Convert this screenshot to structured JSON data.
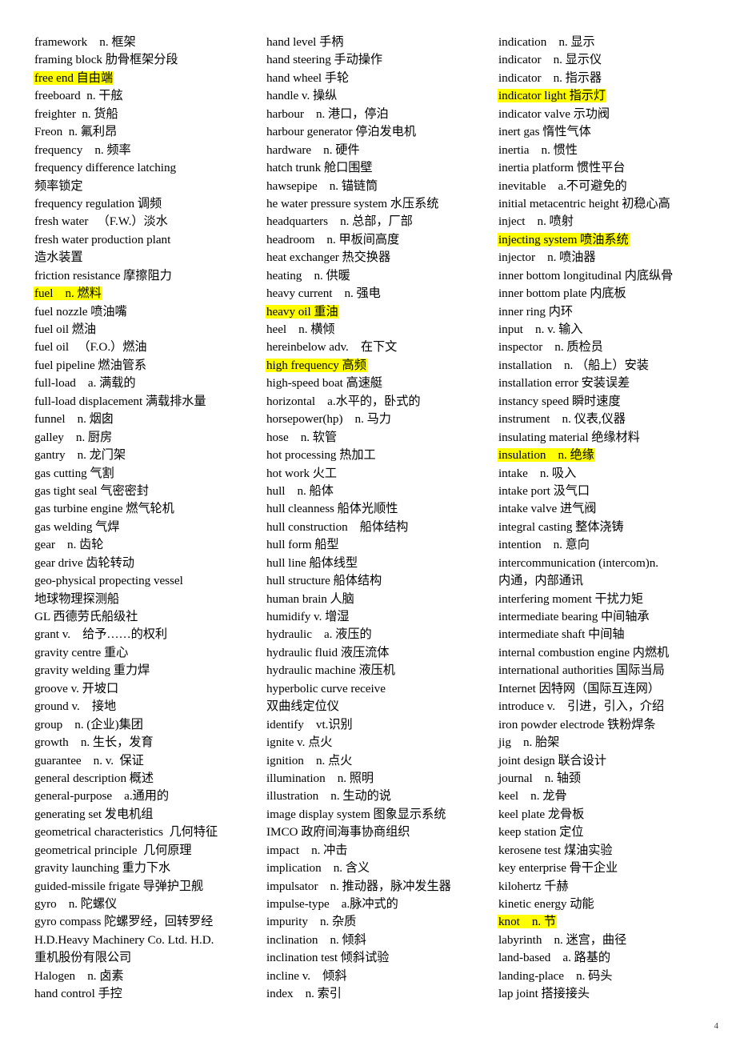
{
  "document": {
    "page_number": "4",
    "highlight_color": "#ffff00",
    "columns": [
      {
        "id": "column-1",
        "entries": [
          {
            "text": "framework n. 框架",
            "highlighted": false
          },
          {
            "text": "framing block  肋骨框架分段",
            "highlighted": false
          },
          {
            "text": "free end  自由端",
            "highlighted": true
          },
          {
            "text": "freeboard n. 干舷",
            "highlighted": false
          },
          {
            "text": "freighter n. 货船",
            "highlighted": false
          },
          {
            "text": "Freon n. 氟利昂",
            "highlighted": false
          },
          {
            "text": "frequency  n. 频率",
            "highlighted": false
          },
          {
            "text": "frequency difference latching",
            "highlighted": false
          },
          {
            "text": "频率锁定",
            "highlighted": false
          },
          {
            "text": "frequency regulation  调频",
            "highlighted": false
          },
          {
            "text": "fresh water  （F.W.）淡水",
            "highlighted": false
          },
          {
            "text": "fresh water production plant",
            "highlighted": false
          },
          {
            "text": "造水装置",
            "highlighted": false
          },
          {
            "text": "friction resistance  摩擦阻力",
            "highlighted": false
          },
          {
            "text": "fuel  n. 燃料",
            "highlighted": true
          },
          {
            "text": "fuel nozzle  喷油嘴",
            "highlighted": false
          },
          {
            "text": "fuel oil  燃油",
            "highlighted": false
          },
          {
            "text": "fuel oil  （F.O.）燃油",
            "highlighted": false
          },
          {
            "text": "fuel pipeline  燃油管系",
            "highlighted": false
          },
          {
            "text": "full-load  a. 满载的",
            "highlighted": false
          },
          {
            "text": "full-load displacement  满载排水量",
            "highlighted": false
          },
          {
            "text": "funnel  n. 烟囱",
            "highlighted": false
          },
          {
            "text": "galley  n. 厨房",
            "highlighted": false
          },
          {
            "text": "gantry  n. 龙门架",
            "highlighted": false
          },
          {
            "text": "gas cutting  气割",
            "highlighted": false
          },
          {
            "text": "gas tight seal  气密密封",
            "highlighted": false
          },
          {
            "text": "gas turbine engine  燃气轮机",
            "highlighted": false
          },
          {
            "text": "gas welding  气焊",
            "highlighted": false
          },
          {
            "text": "gear  n. 齿轮",
            "highlighted": false
          },
          {
            "text": "gear drive  齿轮转动",
            "highlighted": false
          },
          {
            "text": "geo-physical propecting vessel",
            "highlighted": false
          },
          {
            "text": "地球物理探测船",
            "highlighted": false
          },
          {
            "text": "GL  西德劳氏船级社",
            "highlighted": false
          },
          {
            "text": "grant v.  给予……的权利",
            "highlighted": false
          },
          {
            "text": "gravity centre  重心",
            "highlighted": false
          },
          {
            "text": "gravity welding  重力焊",
            "highlighted": false
          },
          {
            "text": "groove v.  开坡口",
            "highlighted": false
          },
          {
            "text": "ground v.  接地",
            "highlighted": false
          },
          {
            "text": "group  n. (企业)集团",
            "highlighted": false
          },
          {
            "text": "growth  n. 生长，发育",
            "highlighted": false
          },
          {
            "text": "guarantee  n. v. 保证",
            "highlighted": false
          },
          {
            "text": "general description  概述",
            "highlighted": false
          },
          {
            "text": "general-purpose  a.通用的",
            "highlighted": false
          },
          {
            "text": "generating set  发电机组",
            "highlighted": false
          },
          {
            "text": "geometrical characteristics 几何特征",
            "highlighted": false
          },
          {
            "text": "geometrical principle 几何原理",
            "highlighted": false
          },
          {
            "text": "gravity launching  重力下水",
            "highlighted": false
          },
          {
            "text": "guided-missile frigate  导弹护卫舰",
            "highlighted": false
          },
          {
            "text": "gyro  n. 陀螺仪",
            "highlighted": false
          },
          {
            "text": "gyro compass  陀螺罗经，回转罗经",
            "highlighted": false
          },
          {
            "text": "H.D.Heavy Machinery Co. Ltd. H.D.",
            "highlighted": false
          },
          {
            "text": "重机股份有限公司",
            "highlighted": false
          },
          {
            "text": "Halogen  n. 卤素",
            "highlighted": false
          },
          {
            "text": "hand control  手控",
            "highlighted": false
          }
        ]
      },
      {
        "id": "column-2",
        "entries": [
          {
            "text": "hand level  手柄",
            "highlighted": false
          },
          {
            "text": "hand steering  手动操作",
            "highlighted": false
          },
          {
            "text": "hand wheel  手轮",
            "highlighted": false
          },
          {
            "text": "handle v.  操纵",
            "highlighted": false
          },
          {
            "text": "harbour  n. 港口，停泊",
            "highlighted": false
          },
          {
            "text": "harbour generator  停泊发电机",
            "highlighted": false
          },
          {
            "text": "hardware  n. 硬件",
            "highlighted": false
          },
          {
            "text": "hatch trunk  舱口围壁",
            "highlighted": false
          },
          {
            "text": "hawsepipe  n. 锚链筒",
            "highlighted": false
          },
          {
            "text": "he water pressure system  水压系统",
            "highlighted": false
          },
          {
            "text": "headquarters  n. 总部，厂部",
            "highlighted": false
          },
          {
            "text": "headroom  n. 甲板间高度",
            "highlighted": false
          },
          {
            "text": "heat exchanger  热交换器",
            "highlighted": false
          },
          {
            "text": "heating  n. 供暖",
            "highlighted": false
          },
          {
            "text": "heavy current  n. 强电",
            "highlighted": false
          },
          {
            "text": "heavy oil  重油",
            "highlighted": true
          },
          {
            "text": "heel  n. 横倾",
            "highlighted": false
          },
          {
            "text": "hereinbelow adv.  在下文",
            "highlighted": false
          },
          {
            "text": "high frequency  高频",
            "highlighted": true
          },
          {
            "text": "high-speed boat  高速艇",
            "highlighted": false
          },
          {
            "text": "horizontal  a.水平的，卧式的",
            "highlighted": false
          },
          {
            "text": "horsepower(hp)  n. 马力",
            "highlighted": false
          },
          {
            "text": "hose  n. 软管",
            "highlighted": false
          },
          {
            "text": "hot processing  热加工",
            "highlighted": false
          },
          {
            "text": "hot work  火工",
            "highlighted": false
          },
          {
            "text": "hull  n. 船体",
            "highlighted": false
          },
          {
            "text": "hull cleanness  船体光顺性",
            "highlighted": false
          },
          {
            "text": "hull construction  船体结构",
            "highlighted": false
          },
          {
            "text": "hull form  船型",
            "highlighted": false
          },
          {
            "text": "hull line  船体线型",
            "highlighted": false
          },
          {
            "text": "hull structure  船体结构",
            "highlighted": false
          },
          {
            "text": "human brain  人脑",
            "highlighted": false
          },
          {
            "text": "humidify v.  增湿",
            "highlighted": false
          },
          {
            "text": "hydraulic  a. 液压的",
            "highlighted": false
          },
          {
            "text": "hydraulic fluid  液压流体",
            "highlighted": false
          },
          {
            "text": "hydraulic machine  液压机",
            "highlighted": false
          },
          {
            "text": "hyperbolic curve receive",
            "highlighted": false
          },
          {
            "text": "双曲线定位仪",
            "highlighted": false
          },
          {
            "text": "identify  vt.识别",
            "highlighted": false
          },
          {
            "text": "ignite v.  点火",
            "highlighted": false
          },
          {
            "text": "ignition  n. 点火",
            "highlighted": false
          },
          {
            "text": "illumination  n. 照明",
            "highlighted": false
          },
          {
            "text": "illustration  n. 生动的说",
            "highlighted": false
          },
          {
            "text": "image display system  图象显示系统",
            "highlighted": false
          },
          {
            "text": "IMCO  政府间海事协商组织",
            "highlighted": false
          },
          {
            "text": "impact  n. 冲击",
            "highlighted": false
          },
          {
            "text": "implication  n. 含义",
            "highlighted": false
          },
          {
            "text": "impulsator  n. 推动器，脉冲发生器",
            "highlighted": false
          },
          {
            "text": "impulse-type  a.脉冲式的",
            "highlighted": false
          },
          {
            "text": "impurity  n. 杂质",
            "highlighted": false
          },
          {
            "text": "inclination  n. 倾斜",
            "highlighted": false
          },
          {
            "text": "inclination test  倾斜试验",
            "highlighted": false
          },
          {
            "text": "incline v.  倾斜",
            "highlighted": false
          },
          {
            "text": "index  n. 索引",
            "highlighted": false
          }
        ]
      },
      {
        "id": "column-3",
        "entries": [
          {
            "text": "indication  n. 显示",
            "highlighted": false
          },
          {
            "text": "indicator  n. 显示仪",
            "highlighted": false
          },
          {
            "text": "indicator  n. 指示器",
            "highlighted": false
          },
          {
            "text": "indicator light  指示灯",
            "highlighted": true
          },
          {
            "text": "indicator valve 示功阀",
            "highlighted": false
          },
          {
            "text": "inert gas  惰性气体",
            "highlighted": false
          },
          {
            "text": "inertia  n. 惯性",
            "highlighted": false
          },
          {
            "text": "inertia platform  惯性平台",
            "highlighted": false
          },
          {
            "text": "inevitable  a.不可避免的",
            "highlighted": false
          },
          {
            "text": "initial metacentric height  初稳心高",
            "highlighted": false
          },
          {
            "text": "inject  n. 喷射",
            "highlighted": false
          },
          {
            "text": "injecting system  喷油系统",
            "highlighted": true
          },
          {
            "text": "injector  n. 喷油器",
            "highlighted": false
          },
          {
            "text": "inner bottom longitudinal  内底纵骨",
            "highlighted": false
          },
          {
            "text": "inner bottom plate  内底板",
            "highlighted": false
          },
          {
            "text": "inner ring  内环",
            "highlighted": false
          },
          {
            "text": "input  n. v. 输入",
            "highlighted": false
          },
          {
            "text": "inspector  n. 质检员",
            "highlighted": false
          },
          {
            "text": "installation  n. （船上）安装",
            "highlighted": false
          },
          {
            "text": "installation error  安装误差",
            "highlighted": false
          },
          {
            "text": "instancy speed  瞬时速度",
            "highlighted": false
          },
          {
            "text": "instrument  n. 仪表,仪器",
            "highlighted": false
          },
          {
            "text": "insulating material  绝缘材料",
            "highlighted": false
          },
          {
            "text": "insulation  n. 绝缘",
            "highlighted": true
          },
          {
            "text": "intake  n. 吸入",
            "highlighted": false
          },
          {
            "text": "intake port  汲气口",
            "highlighted": false
          },
          {
            "text": "intake valve  进气阀",
            "highlighted": false
          },
          {
            "text": "integral casting  整体浇铸",
            "highlighted": false
          },
          {
            "text": "intention  n. 意向",
            "highlighted": false
          },
          {
            "text": "intercommunication (intercom)n.",
            "highlighted": false
          },
          {
            "text": "内通，内部通讯",
            "highlighted": false
          },
          {
            "text": "interfering moment  干扰力矩",
            "highlighted": false
          },
          {
            "text": "intermediate bearing  中间轴承",
            "highlighted": false
          },
          {
            "text": "intermediate shaft  中间轴",
            "highlighted": false
          },
          {
            "text": "internal combustion engine  内燃机",
            "highlighted": false
          },
          {
            "text": "international authorities  国际当局",
            "highlighted": false
          },
          {
            "text": "Internet  因特网（国际互连网）",
            "highlighted": false
          },
          {
            "text": "introduce v.  引进，引入，介绍",
            "highlighted": false
          },
          {
            "text": "iron powder electrode  铁粉焊条",
            "highlighted": false
          },
          {
            "text": "jig  n. 胎架",
            "highlighted": false
          },
          {
            "text": "joint design  联合设计",
            "highlighted": false
          },
          {
            "text": "journal  n. 轴颈",
            "highlighted": false
          },
          {
            "text": "keel  n. 龙骨",
            "highlighted": false
          },
          {
            "text": "keel plate  龙骨板",
            "highlighted": false
          },
          {
            "text": "keep station  定位",
            "highlighted": false
          },
          {
            "text": "kerosene test  煤油实验",
            "highlighted": false
          },
          {
            "text": "key enterprise  骨干企业",
            "highlighted": false
          },
          {
            "text": "kilohertz  千赫",
            "highlighted": false
          },
          {
            "text": "kinetic energy  动能",
            "highlighted": false
          },
          {
            "text": "knot  n. 节",
            "highlighted": true
          },
          {
            "text": "labyrinth  n. 迷宫，曲径",
            "highlighted": false
          },
          {
            "text": "land-based  a. 路基的",
            "highlighted": false
          },
          {
            "text": "landing-place  n. 码头",
            "highlighted": false
          },
          {
            "text": "lap joint  搭接接头",
            "highlighted": false
          }
        ]
      }
    ]
  }
}
